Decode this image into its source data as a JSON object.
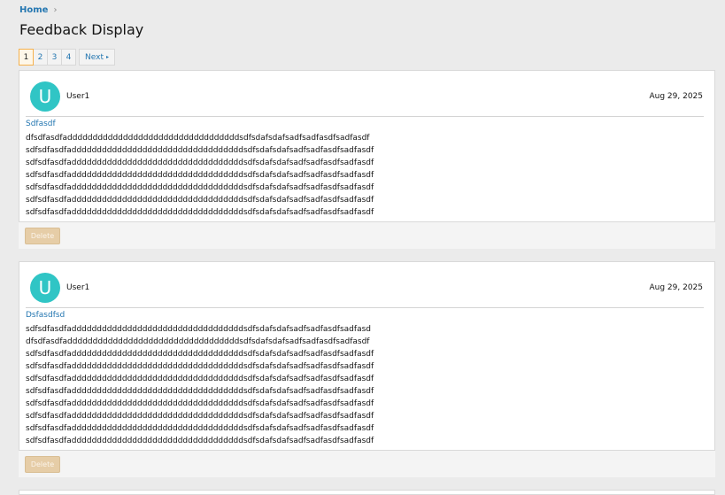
{
  "breadcrumb": {
    "home": "Home",
    "separator": "›"
  },
  "page_title": "Feedback Display",
  "pagination": {
    "pages": [
      "1",
      "2",
      "3",
      "4"
    ],
    "current": "1",
    "next_label": "Next",
    "next_arrow": "▸"
  },
  "feedback": [
    {
      "avatar_letter": "U",
      "user": "User1",
      "date": "Aug 29, 2025",
      "subject": "Sdfasdf",
      "lines": [
        "dfsdfasdfaddddddddddddddddddddddddddddddddddsdfsdafsdafsadfsadfasdfsadfasdf",
        "sdfsdfasdfaddddddddddddddddddddddddddddddddddsdfsdafsdafsadfsadfasdfsadfasdf",
        "sdfsdfasdfaddddddddddddddddddddddddddddddddddsdfsdafsdafsadfsadfasdfsadfasdf",
        "sdfsdfasdfaddddddddddddddddddddddddddddddddddsdfsdafsdafsadfsadfasdfsadfasdf",
        "sdfsdfasdfaddddddddddddddddddddddddddddddddddsdfsdafsdafsadfsadfasdfsadfasdf",
        "sdfsdfasdfaddddddddddddddddddddddddddddddddddsdfsdafsdafsadfsadfasdfsadfasdf",
        "sdfsdfasdfaddddddddddddddddddddddddddddddddddsdfsdafsdafsadfsadfasdfsadfasdf"
      ],
      "delete_label": "Delete"
    },
    {
      "avatar_letter": "U",
      "user": "User1",
      "date": "Aug 29, 2025",
      "subject": "Dsfasdfsd",
      "lines": [
        "sdfsdfasdfaddddddddddddddddddddddddddddddddddsdfsdafsdafsadfsadfasdfsadfasd",
        "dfsdfasdfaddddddddddddddddddddddddddddddddddsdfsdafsdafsadfsadfasdfsadfasdf",
        "sdfsdfasdfaddddddddddddddddddddddddddddddddddsdfsdafsdafsadfsadfasdfsadfasdf",
        "sdfsdfasdfaddddddddddddddddddddddddddddddddddsdfsdafsdafsadfsadfasdfsadfasdf",
        "sdfsdfasdfaddddddddddddddddddddddddddddddddddsdfsdafsdafsadfsadfasdfsadfasdf",
        "sdfsdfasdfaddddddddddddddddddddddddddddddddddsdfsdafsdafsadfsadfasdfsadfasdf",
        "sdfsdfasdfaddddddddddddddddddddddddddddddddddsdfsdafsdafsadfsadfasdfsadfasdf",
        "sdfsdfasdfaddddddddddddddddddddddddddddddddddsdfsdafsdafsadfsadfasdfsadfasdf",
        "sdfsdfasdfaddddddddddddddddddddddddddddddddddsdfsdafsdafsadfsadfasdfsadfasdf",
        "sdfsdfasdfaddddddddddddddddddddddddddddddddddsdfsdafsdafsadfsadfasdfsadfasdf"
      ],
      "delete_label": "Delete"
    }
  ],
  "colors": {
    "accent": "#2577b1",
    "avatar": "#30c5c5",
    "delete_button": "#e6cda7",
    "current_page_border": "#f5b14e"
  }
}
